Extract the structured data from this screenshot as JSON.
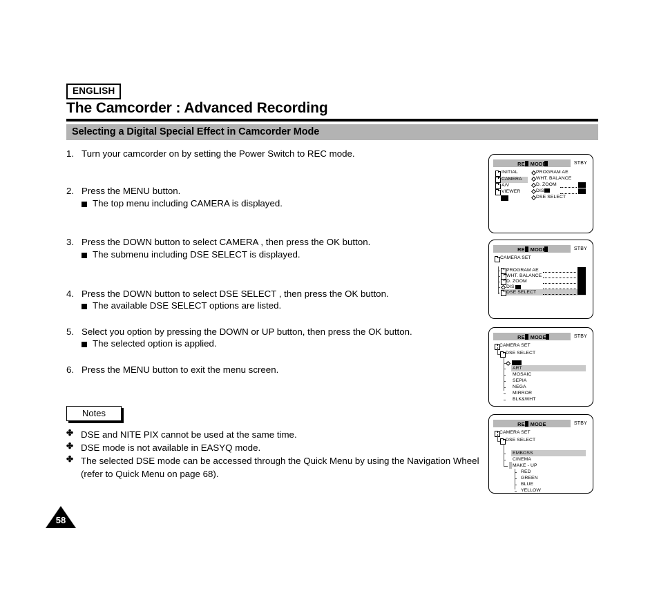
{
  "header": {
    "language_badge": "ENGLISH",
    "title": "The Camcorder : Advanced Recording",
    "section_title": "Selecting a Digital Special Effect in Camcorder Mode"
  },
  "steps": [
    {
      "num": "1.",
      "text": "Turn your camcorder on by setting the Power Switch to REC mode.",
      "subs": []
    },
    {
      "num": "2.",
      "text": "Press the MENU button.",
      "subs": [
        "The top menu including  CAMERA  is displayed."
      ]
    },
    {
      "num": "3.",
      "text": "Press the DOWN button to select  CAMERA , then press the OK button.",
      "subs": [
        "The submenu including  DSE SELECT  is displayed."
      ]
    },
    {
      "num": "4.",
      "text": "Press the DOWN button to select  DSE SELECT , then press the OK button.",
      "subs": [
        "The available DSE SELECT options are listed."
      ]
    },
    {
      "num": "5.",
      "text": "Select you option by pressing the DOWN or UP button, then press the OK button.",
      "subs": [
        "The selected option is applied."
      ]
    },
    {
      "num": "6.",
      "text": "Press the MENU button to exit the menu screen.",
      "subs": []
    }
  ],
  "notes": {
    "label": "Notes",
    "items": [
      "DSE and NITE PIX cannot be used at the same time.",
      "DSE mode is not available in EASYQ mode.",
      "The selected DSE mode can be accessed through the Quick Menu by using the Navigation Wheel (refer to Quick Menu on page 68)."
    ]
  },
  "page_number": "58",
  "screens": [
    {
      "title": "REC MODE",
      "status": "STBY",
      "left_menu": [
        "INITIAL",
        "CAMERA",
        "A/V",
        "VIEWER"
      ],
      "left_selected": "CAMERA",
      "right_menu": [
        "PROGRAM AE",
        "WHT. BALANCE",
        "D. ZOOM",
        "DIS",
        "DSE SELECT"
      ]
    },
    {
      "title": "REC MODE",
      "status": "STBY",
      "root": "CAMERA SET",
      "items": [
        "PROGRAM AE",
        "WHT. BALANCE",
        "D. ZOOM",
        "DIS",
        "DSE SELECT"
      ],
      "selected": "DSE SELECT"
    },
    {
      "title": "REC MODE",
      "status": "STBY",
      "root": "CAMERA SET",
      "sub_root": "DSE SELECT",
      "options": [
        "ART",
        "MOSAIC",
        "SEPIA",
        "NEGA",
        "MIRROR",
        "BLK&WHT"
      ],
      "selected": "ART"
    },
    {
      "title": "REC MODE",
      "status": "STBY",
      "root": "CAMERA SET",
      "sub_root": "DSE SELECT",
      "options": [
        "EMBOSS",
        "CINEMA",
        "MAKE - UP"
      ],
      "selected": "EMBOSS",
      "colors": [
        "RED",
        "GREEN",
        "BLUE",
        "YELLOW"
      ]
    }
  ],
  "colors": {
    "section_bar": "#b3b3b3",
    "lcd_header": "#b7b7b7",
    "lcd_highlight": "#c9c9c9"
  }
}
